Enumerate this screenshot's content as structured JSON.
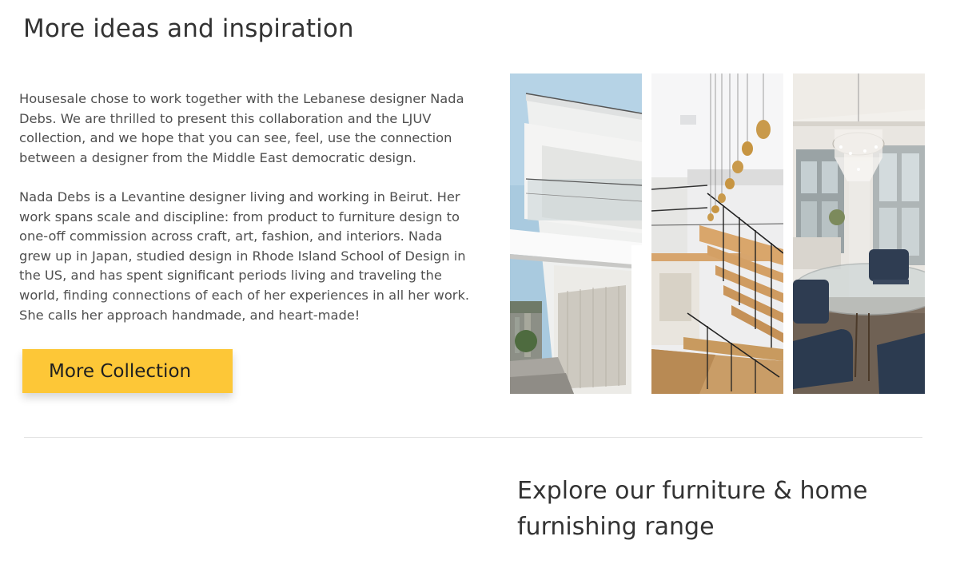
{
  "inspiration": {
    "title": "More ideas and inspiration",
    "paragraphs": [
      "Housesale chose to work together with the Lebanese designer Nada Debs. We are thrilled to present this collaboration and the LJUV collection, and we hope that you can see, feel, use the connection between a designer from the Middle East  democratic design.",
      "Nada Debs is a Levantine designer living and working in Beirut. Her work spans scale and discipline: from product to furniture design to one-off commission across craft, art, fashion, and interiors. Nada grew up in Japan, studied design in Rhode Island School of Design in the US, and has spent significant periods living and traveling the world, finding connections of each of her experiences in all her work. She calls her approach handmade, and heart-made!"
    ],
    "cta_label": "More Collection",
    "accent_color": "#FDC737"
  },
  "gallery": {
    "images": [
      {
        "subject": "modern white building exterior with balconies"
      },
      {
        "subject": "staircase with wooden steps and golden pendant lights"
      },
      {
        "subject": "dining room with glass table, blue chairs and crystal chandelier"
      }
    ]
  },
  "explore": {
    "title": "Explore our furniture & home furnishing range"
  }
}
